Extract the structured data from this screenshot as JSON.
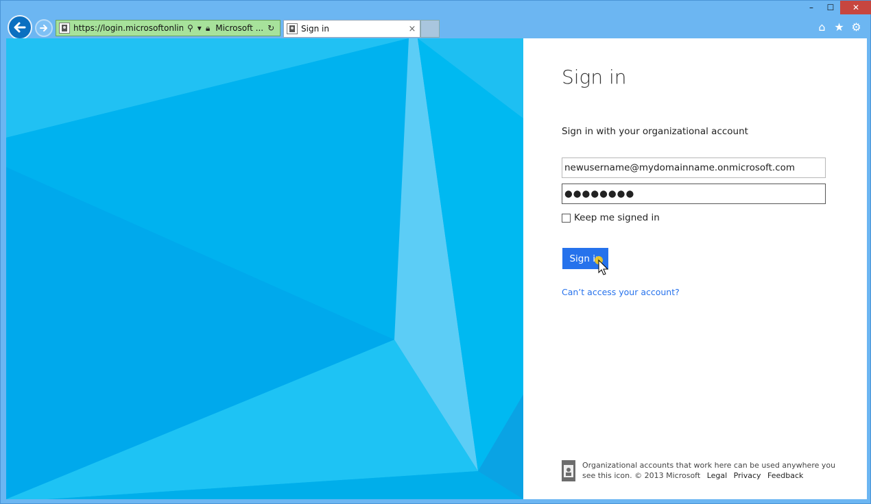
{
  "browser": {
    "address_url": "https://login.microsoftonlin...",
    "address_site": "Microsoft ...",
    "tab_title": "Sign in",
    "tab_close": "×",
    "window_controls": {
      "minimize": "–",
      "maximize": "☐",
      "close": "✕"
    },
    "toolbar_icons": [
      "home-icon",
      "favorites-star-icon",
      "settings-gear-icon"
    ]
  },
  "signin": {
    "title": "Sign in",
    "subtitle": "Sign in with your organizational account",
    "email_value": "newusername@mydomainname.onmicrosoft.com",
    "password_value": "●●●●●●●●",
    "keep_signed_in_label": "Keep me signed in",
    "keep_signed_in_checked": false,
    "button_label": "Sign in",
    "cant_access_link": "Can’t access your account?"
  },
  "footer": {
    "text": "Organizational accounts that work here can be used anywhere you see this icon. © 2013 Microsoft",
    "links": [
      "Legal",
      "Privacy",
      "Feedback"
    ]
  },
  "colors": {
    "accent": "#2672ec",
    "hero_blue": "#00b4f0",
    "address_bar": "#a7e29b",
    "close_button": "#c7463f"
  }
}
